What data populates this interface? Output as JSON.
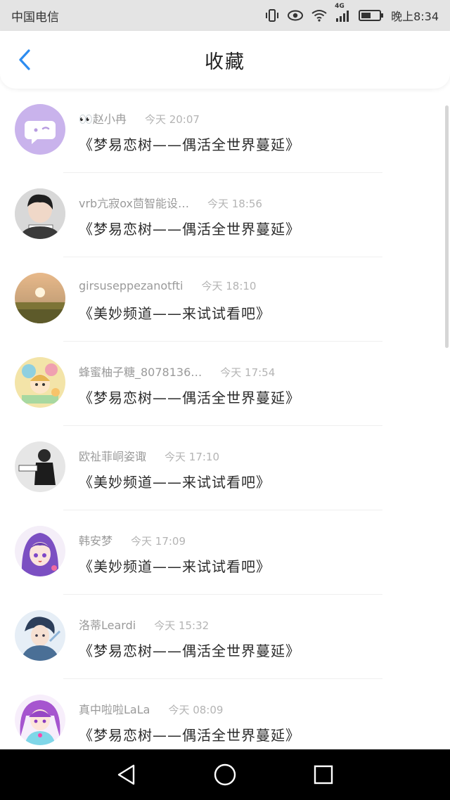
{
  "status_bar": {
    "carrier": "中国电信",
    "network": "4G",
    "time": "晚上8:34",
    "icons": [
      "vibrate-icon",
      "eye-icon",
      "wifi-icon",
      "signal-icon",
      "battery-icon"
    ]
  },
  "header": {
    "title": "收藏",
    "back_icon": "chevron-left-icon",
    "accent_color": "#2d8cf0"
  },
  "items": [
    {
      "user": "👀赵小冉",
      "time": "今天 20:07",
      "message": "《梦易恋树——偶活全世界蔓延》",
      "avatar": "chat-bubble-avatar",
      "avatar_color": "#c9b3ec"
    },
    {
      "user": "vrb亢寂ox茴智能设…",
      "time": "今天 18:56",
      "message": "《梦易恋树——偶活全世界蔓延》",
      "avatar": "person-photo-avatar",
      "avatar_color": "#3a3a3a"
    },
    {
      "user": "girsuseppezanotfti",
      "time": "今天 18:10",
      "message": "《美妙频道——来试试看吧》",
      "avatar": "landscape-avatar",
      "avatar_color": "#8a7a46"
    },
    {
      "user": "蜂蜜柚子糖_8078136…",
      "time": "今天 17:54",
      "message": "《梦易恋树——偶活全世界蔓延》",
      "avatar": "cartoon-avatar",
      "avatar_color": "#e8c66a"
    },
    {
      "user": "欧祉菲峒姿诹",
      "time": "今天 17:10",
      "message": "《美妙频道——来试试看吧》",
      "avatar": "bw-figure-avatar",
      "avatar_color": "#2e2e2e"
    },
    {
      "user": "韩安梦",
      "time": "今天 17:09",
      "message": "《美妙频道——来试试看吧》",
      "avatar": "anime-girl-avatar",
      "avatar_color": "#8b5fc7"
    },
    {
      "user": "洛蒂Leardi",
      "time": "今天 15:32",
      "message": "《梦易恋树——偶活全世界蔓延》",
      "avatar": "anime-boy-avatar",
      "avatar_color": "#5c7fa6"
    },
    {
      "user": "真中啦啦LaLa",
      "time": "今天 08:09",
      "message": "《梦易恋树——偶活全世界蔓延》",
      "avatar": "idol-girl-avatar",
      "avatar_color": "#b46ad0"
    }
  ],
  "nav_bar": {
    "icons": [
      "back-triangle-icon",
      "home-circle-icon",
      "recents-square-icon"
    ]
  }
}
